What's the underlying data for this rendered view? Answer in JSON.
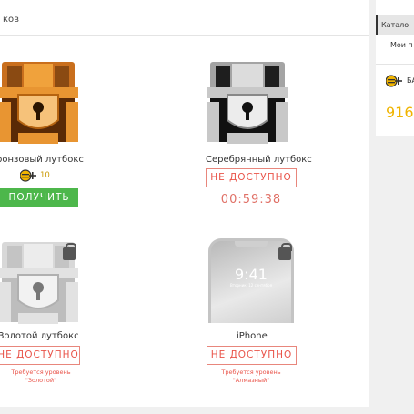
{
  "header": {
    "title": "ков"
  },
  "cards": [
    {
      "title": "ронзовый лутбокс",
      "price": "10",
      "button": "ПОЛУЧИТЬ"
    },
    {
      "title": "Серебрянный лутбокс",
      "button": "НЕ ДОСТУПНО",
      "timer": "00:59:38"
    },
    {
      "title": "Золотой лутбокс",
      "button": "НЕ ДОСТУПНО",
      "requirement_line1": "Требуется уровень",
      "requirement_line2": "\"Золотой\""
    },
    {
      "title": "iPhone",
      "button": "НЕ ДОСТУПНО",
      "requirement_line1": "Требуется уровень",
      "requirement_line2": "\"Алмазный\""
    }
  ],
  "phone_screen": {
    "time": "9:41",
    "date": "Вторник, 12 сентября"
  },
  "sidebar": {
    "tab_active": "Катало",
    "item": "Мои п",
    "balance_label": "БА",
    "balance_value": "916 I"
  },
  "colors": {
    "bronze": "#d97f2a",
    "silver": "#9a9a9a",
    "green": "#4db74b",
    "red": "#e9544a",
    "coin": "#f0b400"
  }
}
